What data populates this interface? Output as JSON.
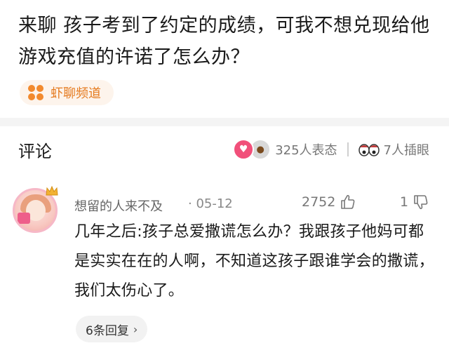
{
  "article": {
    "title": "来聊 孩子考到了约定的成绩，可我不想兑现给他游戏充值的许诺了怎么办？"
  },
  "channel": {
    "icon": "four-dots-icon",
    "label": "虾聊频道",
    "accent": "#f28a2e"
  },
  "comments_header": {
    "title": "评论",
    "reaction_count_text": "325人表态",
    "eye_roll_text": "7人插眼"
  },
  "comment": {
    "username": "想留的人来不及",
    "date": "· 05-12",
    "likes": "2752",
    "dislikes": "1",
    "text": "几年之后:孩子总爱撒谎怎么办？我跟孩子他妈可都是实实在在的人啊，不知道这孩子跟谁学会的撒谎，我们太伤心了。",
    "replies_label": "6条回复",
    "replies_chevron": "›"
  }
}
